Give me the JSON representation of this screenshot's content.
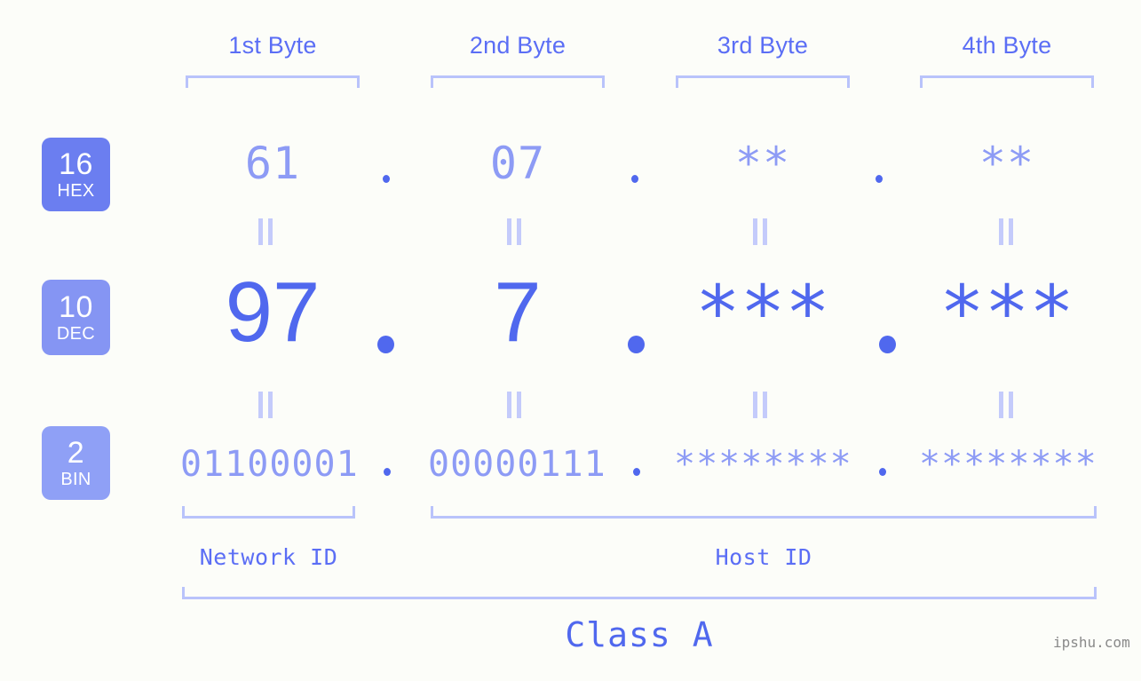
{
  "meta": {
    "background_color": "#fcfdf9",
    "accent_color": "#5068ee",
    "light_accent_color": "#8d9bf5",
    "bracket_color": "#b9c3fb",
    "watermark": "ipshu.com"
  },
  "byte_headers": [
    {
      "label": "1st Byte"
    },
    {
      "label": "2nd Byte"
    },
    {
      "label": "3rd Byte"
    },
    {
      "label": "4th Byte"
    }
  ],
  "bases": [
    {
      "num": "16",
      "label": "HEX",
      "color": "#6b7ef0"
    },
    {
      "num": "10",
      "label": "DEC",
      "color": "#8595f3"
    },
    {
      "num": "2",
      "label": "BIN",
      "color": "#8fa0f6"
    }
  ],
  "rows": {
    "hex": {
      "base_num": "16",
      "base_label": "HEX",
      "values": [
        "61",
        "07",
        "**",
        "**"
      ]
    },
    "dec": {
      "base_num": "10",
      "base_label": "DEC",
      "values": [
        "97",
        "7",
        "***",
        "***"
      ]
    },
    "bin": {
      "base_num": "2",
      "base_label": "BIN",
      "values": [
        "01100001",
        "00000111",
        "********",
        "********"
      ]
    }
  },
  "separators": {
    "dot": "."
  },
  "equivalence": {
    "mark": "||"
  },
  "id_labels": {
    "network": "Network ID",
    "host": "Host ID"
  },
  "class_label": "Class A"
}
